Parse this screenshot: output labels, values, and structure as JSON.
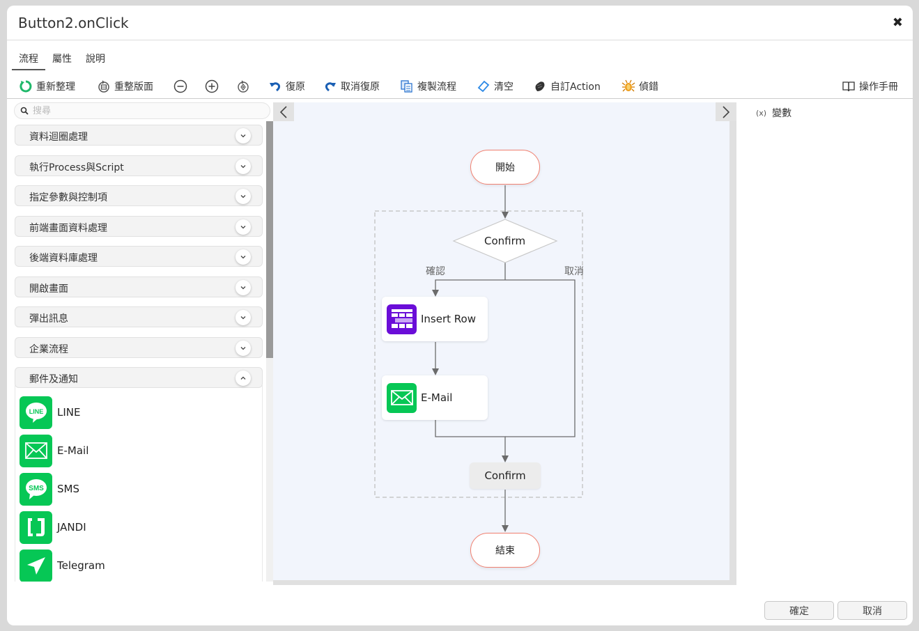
{
  "dialog": {
    "title": "Button2.onClick",
    "close_icon": "close-icon"
  },
  "tabs": [
    {
      "label": "流程",
      "active": true
    },
    {
      "label": "屬性",
      "active": false
    },
    {
      "label": "說明",
      "active": false
    }
  ],
  "toolbar": {
    "refresh": "重新整理",
    "relayout": "重整版面",
    "zoom_out_icon": "zoom-out-icon",
    "zoom_in_icon": "zoom-in-icon",
    "fit_icon": "fit-view-icon",
    "undo": "復原",
    "redo": "取消復原",
    "copy_flow": "複製流程",
    "clear": "清空",
    "custom_action": "自訂Action",
    "debug": "偵錯",
    "manual": "操作手冊"
  },
  "search": {
    "placeholder": "搜尋"
  },
  "categories": [
    {
      "label": "資料迴圈處理",
      "expanded": false
    },
    {
      "label": "執行Process與Script",
      "expanded": false
    },
    {
      "label": "指定參數與控制項",
      "expanded": false
    },
    {
      "label": "前端畫面資料處理",
      "expanded": false
    },
    {
      "label": "後端資料庫處理",
      "expanded": false
    },
    {
      "label": "開啟畫面",
      "expanded": false
    },
    {
      "label": "彈出訊息",
      "expanded": false
    },
    {
      "label": "企業流程",
      "expanded": false
    },
    {
      "label": "郵件及通知",
      "expanded": true
    }
  ],
  "notify_items": [
    {
      "label": "LINE",
      "icon": "line-icon"
    },
    {
      "label": "E-Mail",
      "icon": "email-icon"
    },
    {
      "label": "SMS",
      "icon": "sms-icon"
    },
    {
      "label": "JANDI",
      "icon": "jandi-icon"
    },
    {
      "label": "Telegram",
      "icon": "telegram-icon"
    }
  ],
  "flow": {
    "start": "開始",
    "decision": "Confirm",
    "yes_label": "確認",
    "no_label": "取消",
    "action1": "Insert Row",
    "action2": "E-Mail",
    "merge": "Confirm",
    "end": "結束"
  },
  "right_panel": {
    "var_prefix": "(x)",
    "var_label": "變數"
  },
  "footer": {
    "ok": "確定",
    "cancel": "取消"
  },
  "colors": {
    "notify_green": "#06c755",
    "insert_purple": "#6a0dd8",
    "terminal_border": "#f08070",
    "canvas_bg": "#f2f5fc"
  }
}
